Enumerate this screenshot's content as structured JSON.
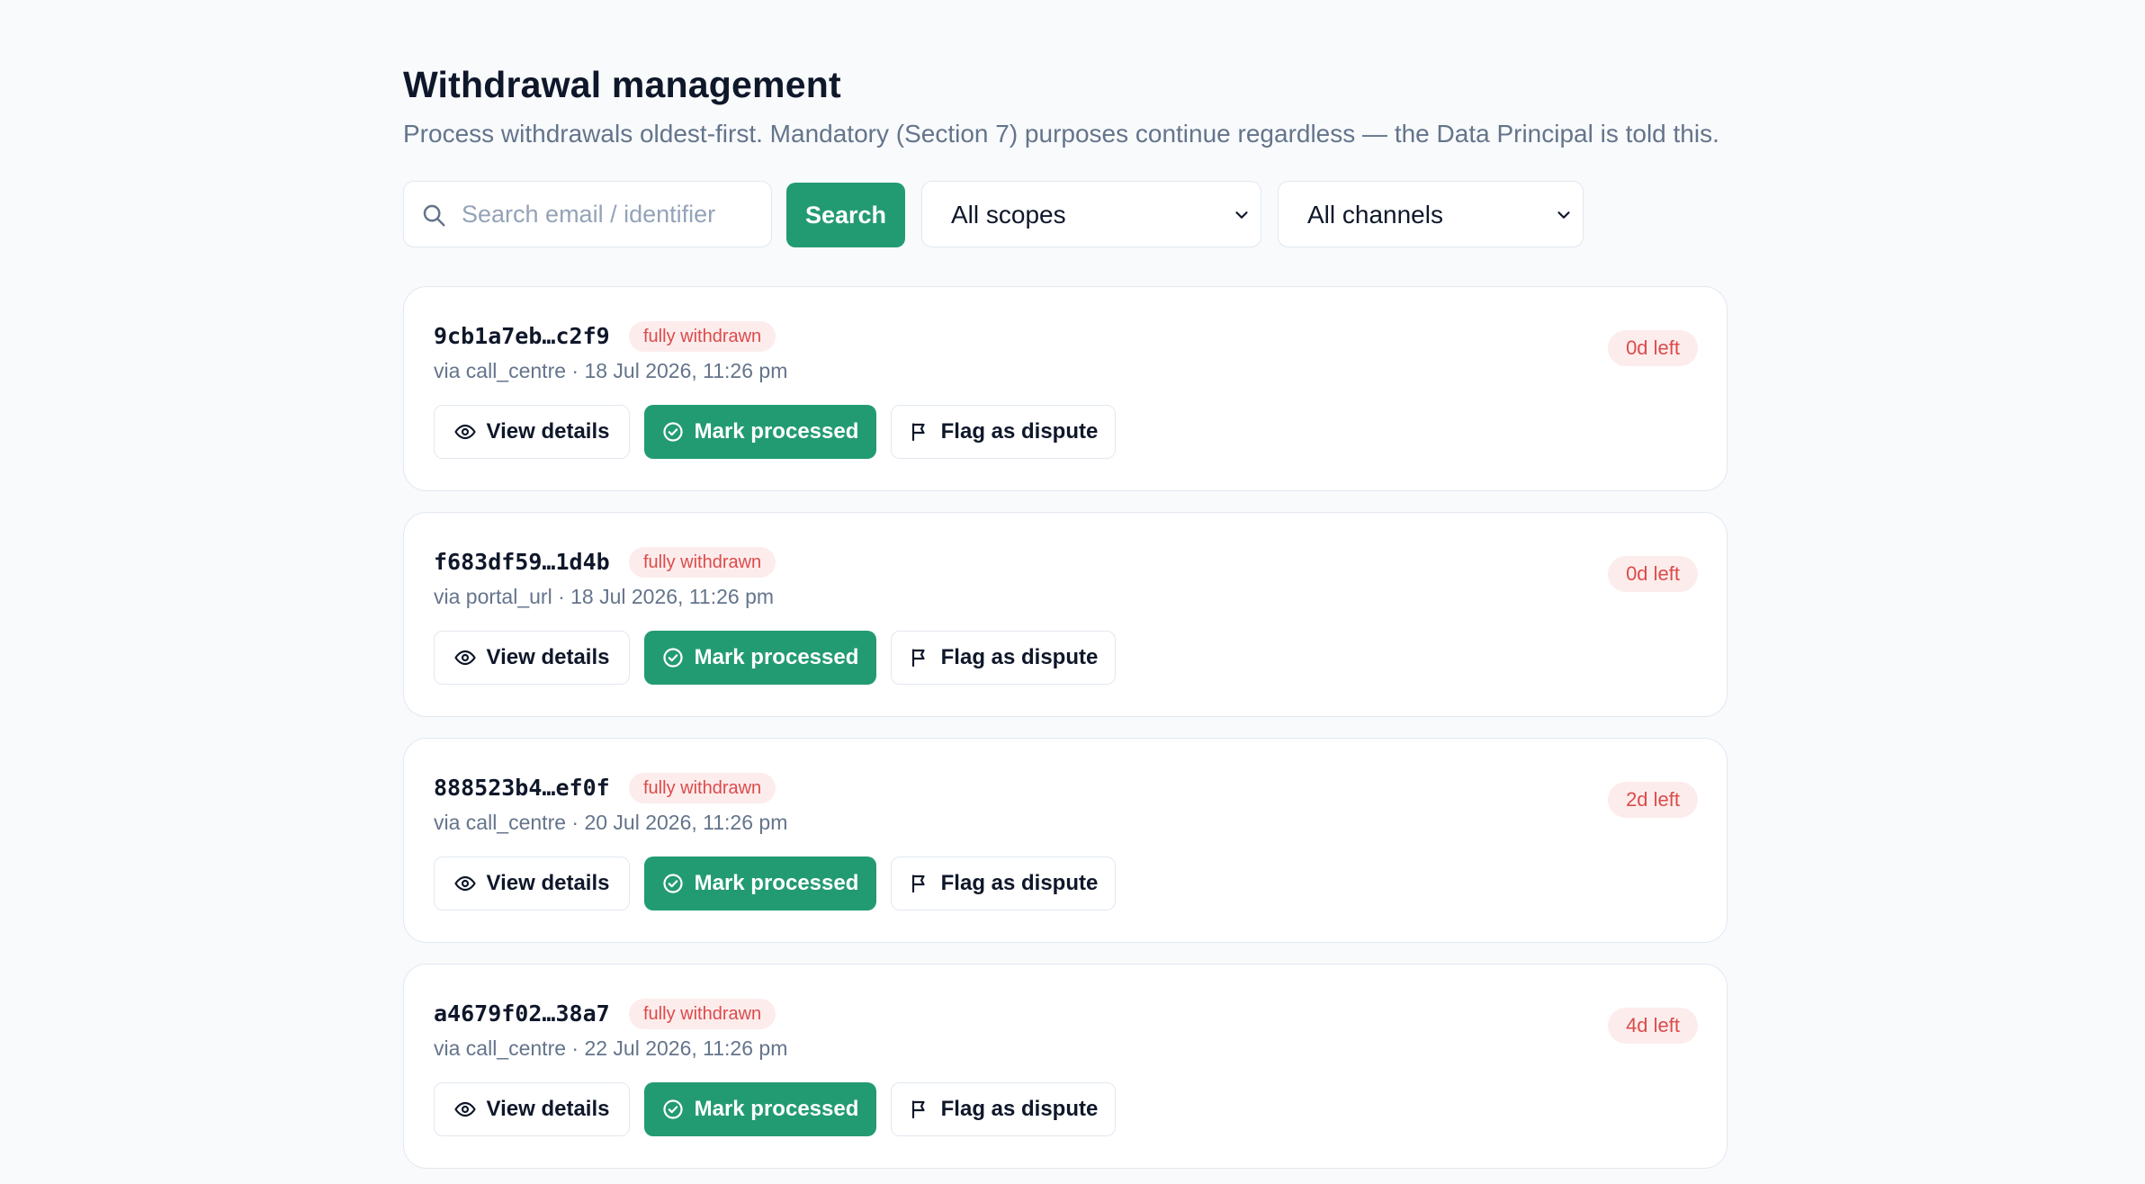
{
  "header": {
    "title": "Withdrawal management",
    "subtitle": "Process withdrawals oldest-first. Mandatory (Section 7) purposes continue regardless — the Data Principal is told this."
  },
  "filters": {
    "search_placeholder": "Search email / identifier",
    "search_value": "",
    "search_button_label": "Search",
    "scope_selected": "All scopes",
    "channel_selected": "All channels"
  },
  "colors": {
    "accent": "#239b72",
    "danger_text": "#dc4b4b",
    "danger_bg": "#fdecec",
    "muted_text": "#64748b",
    "border": "#e2e8f0"
  },
  "icons": {
    "search": "search-icon",
    "select": "chevron-down-icon",
    "view": "eye-icon",
    "process": "check-circle-icon",
    "flag": "flag-icon"
  },
  "withdrawals": [
    {
      "id": "9cb1a7eb…c2f9",
      "status": "fully withdrawn",
      "meta": "via call_centre · 18 Jul 2026, 11:26 pm",
      "deadline": "0d left",
      "view_label": "View details",
      "process_label": "Mark processed",
      "flag_label": "Flag as dispute"
    },
    {
      "id": "f683df59…1d4b",
      "status": "fully withdrawn",
      "meta": "via portal_url · 18 Jul 2026, 11:26 pm",
      "deadline": "0d left",
      "view_label": "View details",
      "process_label": "Mark processed",
      "flag_label": "Flag as dispute"
    },
    {
      "id": "888523b4…ef0f",
      "status": "fully withdrawn",
      "meta": "via call_centre · 20 Jul 2026, 11:26 pm",
      "deadline": "2d left",
      "view_label": "View details",
      "process_label": "Mark processed",
      "flag_label": "Flag as dispute"
    },
    {
      "id": "a4679f02…38a7",
      "status": "fully withdrawn",
      "meta": "via call_centre · 22 Jul 2026, 11:26 pm",
      "deadline": "4d left",
      "view_label": "View details",
      "process_label": "Mark processed",
      "flag_label": "Flag as dispute"
    }
  ]
}
